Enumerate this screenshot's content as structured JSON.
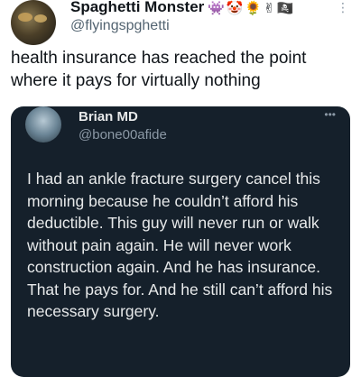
{
  "tweet": {
    "author_name": "Spaghetti Monster",
    "author_emojis": "👾🤡🌻✌🏴‍☠️",
    "handle": "@flyingspghetti",
    "more": "⋮",
    "text": "health insurance has reached the point where it pays for virtually nothing"
  },
  "quoted": {
    "author_name": "Brian MD",
    "handle": "@bone00afide",
    "more": "•••",
    "text": "I had an ankle fracture surgery cancel this morning because he couldn’t afford his deductible. This guy will never run or walk without pain again. He will never work construction again.  And he has insurance. That he pays for.  And he still can’t afford his necessary surgery."
  }
}
